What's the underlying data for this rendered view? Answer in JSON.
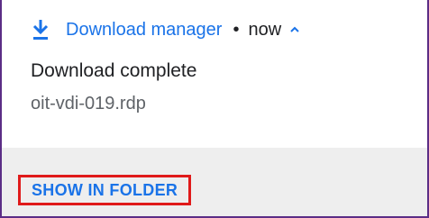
{
  "notification": {
    "app_name": "Download manager",
    "separator": "•",
    "time": "now",
    "title": "Download complete",
    "filename": "oit-vdi-019.rdp",
    "action_label": "SHOW IN FOLDER",
    "icons": {
      "app": "download-icon",
      "expand": "chevron-up-icon"
    },
    "colors": {
      "accent": "#1a73e8",
      "border": "#5b2d86",
      "highlight": "#e01a1a",
      "action_bar_bg": "#eeeeee"
    }
  }
}
